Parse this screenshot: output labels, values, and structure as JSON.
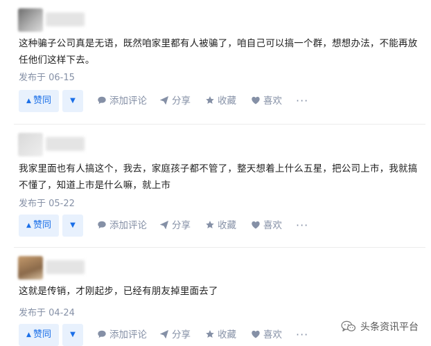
{
  "answers": [
    {
      "content": "这种骗子公司真是无语，既然咱家里都有人被骗了，咱自己可以搞一个群，想想办法，不能再放任他们这样下去。",
      "date": "发布于 06-15"
    },
    {
      "content": "我家里面也有人搞这个，我去，家庭孩子都不管了，整天想着上什么五星，把公司上市，我就搞不懂了，知道上市是什么嘛，就上市",
      "date": "发布于 05-22"
    },
    {
      "content": "这就是传销，才刚起步，已经有朋友掉里面去了",
      "date": "发布于 04-24"
    }
  ],
  "actions": {
    "vote_up": "赞同",
    "comment": "添加评论",
    "share": "分享",
    "collect": "收藏",
    "like": "喜欢",
    "more": "···"
  },
  "icons": {
    "vote_up": "triangle-up-icon",
    "vote_down": "triangle-down-icon",
    "comment": "speech-bubble-icon",
    "share": "paper-plane-icon",
    "collect": "star-icon",
    "like": "heart-icon",
    "more": "ellipsis-icon",
    "watermark": "wechat-logo-icon"
  },
  "watermark": {
    "text": "头条资讯平台"
  },
  "colors": {
    "accent": "#1a6fe8",
    "vote_bg": "#e8f1fd",
    "muted": "#8590a6",
    "text": "#222222"
  }
}
